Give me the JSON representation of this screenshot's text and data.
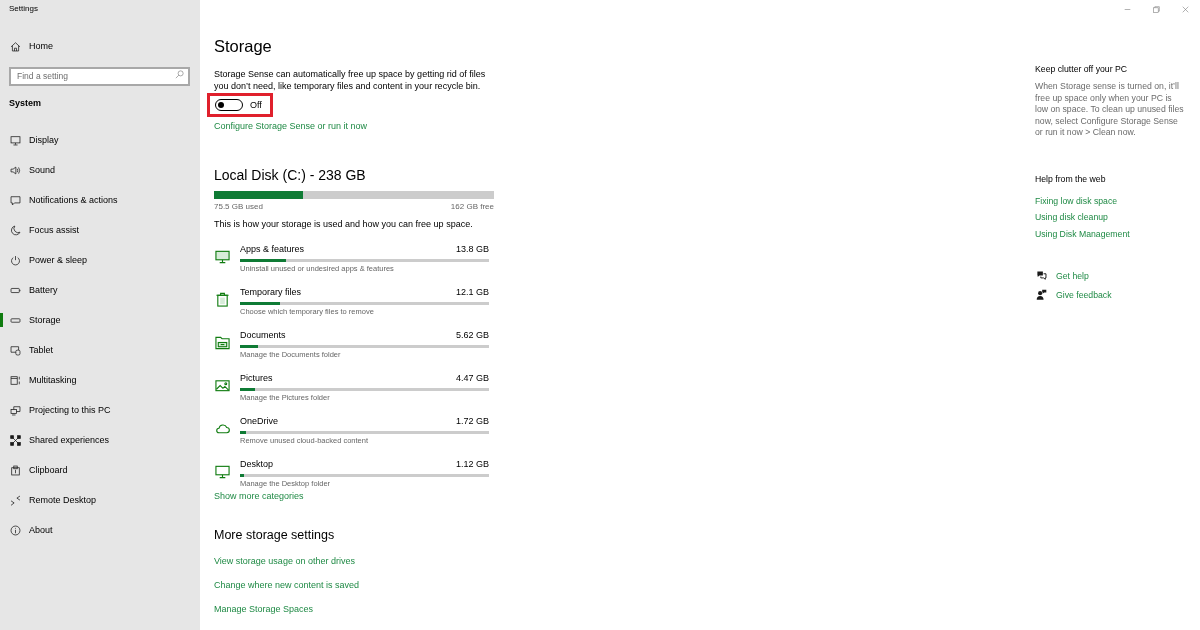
{
  "window": {
    "title": "Settings"
  },
  "sidebar": {
    "home": "Home",
    "search": {
      "placeholder": "Find a setting"
    },
    "section": "System",
    "items": [
      {
        "label": "Display",
        "selected": false
      },
      {
        "label": "Sound",
        "selected": false
      },
      {
        "label": "Notifications & actions",
        "selected": false
      },
      {
        "label": "Focus assist",
        "selected": false
      },
      {
        "label": "Power & sleep",
        "selected": false
      },
      {
        "label": "Battery",
        "selected": false
      },
      {
        "label": "Storage",
        "selected": true
      },
      {
        "label": "Tablet",
        "selected": false
      },
      {
        "label": "Multitasking",
        "selected": false
      },
      {
        "label": "Projecting to this PC",
        "selected": false
      },
      {
        "label": "Shared experiences",
        "selected": false
      },
      {
        "label": "Clipboard",
        "selected": false
      },
      {
        "label": "Remote Desktop",
        "selected": false
      },
      {
        "label": "About",
        "selected": false
      }
    ]
  },
  "main": {
    "title": "Storage",
    "storage_sense": {
      "description": "Storage Sense can automatically free up space by getting rid of files you don’t need, like temporary files and content in your recycle bin.",
      "toggle": {
        "on": false,
        "label": "Off",
        "highlighted": true
      },
      "link": "Configure Storage Sense or run it now"
    },
    "disk": {
      "title": "Local Disk (C:) - 238 GB",
      "level": 0.317,
      "used": "75.5 GB used",
      "free": "162 GB free",
      "description": "This is how your storage is used and how you can free up space."
    },
    "categories": [
      {
        "name": "Apps & features",
        "size": "13.8 GB",
        "level": 0.183,
        "description": "Uninstall unused or undesired apps & features"
      },
      {
        "name": "Temporary files",
        "size": "12.1 GB",
        "level": 0.16,
        "description": "Choose which temporary files to remove"
      },
      {
        "name": "Documents",
        "size": "5.62 GB",
        "level": 0.074,
        "description": "Manage the Documents folder"
      },
      {
        "name": "Pictures",
        "size": "4.47 GB",
        "level": 0.059,
        "description": "Manage the Pictures folder"
      },
      {
        "name": "OneDrive",
        "size": "1.72 GB",
        "level": 0.023,
        "description": "Remove unused cloud-backed content"
      },
      {
        "name": "Desktop",
        "size": "1.12 GB",
        "level": 0.015,
        "description": "Manage the Desktop folder"
      }
    ],
    "show_more": "Show more categories",
    "more_settings": {
      "title": "More storage settings",
      "links": [
        "View storage usage on other drives",
        "Change where new content is saved",
        "Manage Storage Spaces"
      ]
    }
  },
  "side_panel": {
    "keep_clutter": {
      "title": "Keep clutter off your PC",
      "text": "When Storage sense is turned on, it’ll free up space only when your PC is low on space. To clean up unused files now, select Configure Storage Sense or run it now > Clean now."
    },
    "help": {
      "title": "Help from the web",
      "links": [
        "Fixing low disk space",
        "Using disk cleanup",
        "Using Disk Management"
      ]
    },
    "actions": [
      "Get help",
      "Give feedback"
    ]
  }
}
